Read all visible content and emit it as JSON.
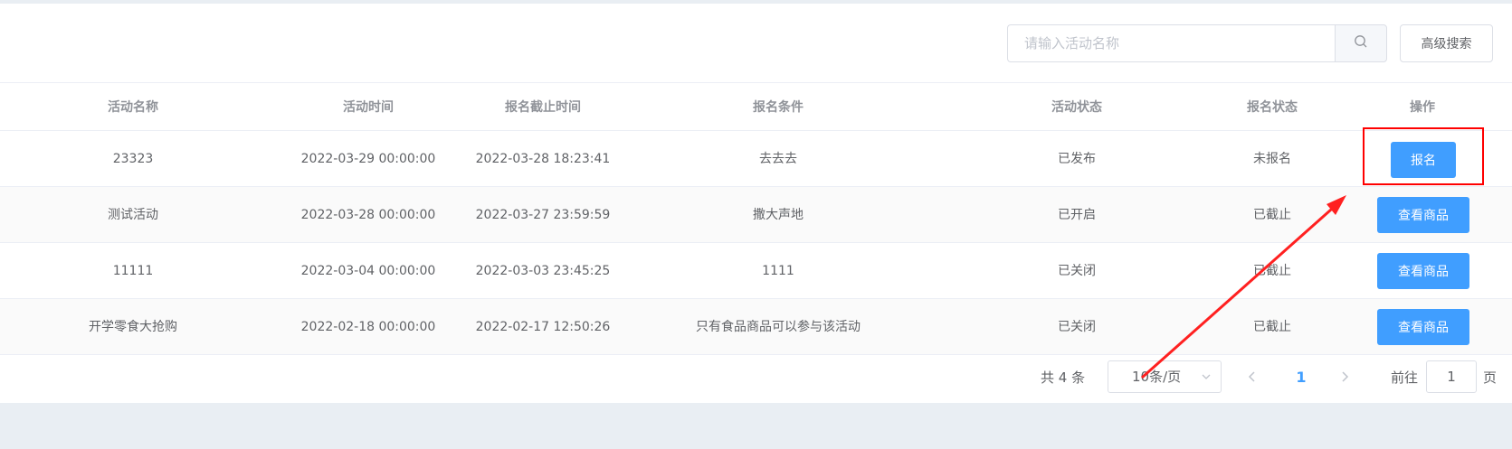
{
  "search": {
    "placeholder": "请输入活动名称",
    "value": "",
    "advanced_label": "高级搜索"
  },
  "table": {
    "headers": [
      "活动名称",
      "活动时间",
      "报名截止时间",
      "报名条件",
      "活动状态",
      "报名状态",
      "操作"
    ],
    "rows": [
      {
        "name": "23323",
        "time": "2022-03-29 00:00:00",
        "deadline": "2022-03-28 18:23:41",
        "condition": "去去去",
        "activity_status": "已发布",
        "signup_status": "未报名",
        "action": "报名"
      },
      {
        "name": "测试活动",
        "time": "2022-03-28 00:00:00",
        "deadline": "2022-03-27 23:59:59",
        "condition": "撒大声地",
        "activity_status": "已开启",
        "signup_status": "已截止",
        "action": "查看商品"
      },
      {
        "name": "11111",
        "time": "2022-03-04 00:00:00",
        "deadline": "2022-03-03 23:45:25",
        "condition": "1111",
        "activity_status": "已关闭",
        "signup_status": "已截止",
        "action": "查看商品"
      },
      {
        "name": "开学零食大抢购",
        "time": "2022-02-18 00:00:00",
        "deadline": "2022-02-17 12:50:26",
        "condition": "只有食品商品可以参与该活动",
        "activity_status": "已关闭",
        "signup_status": "已截止",
        "action": "查看商品"
      }
    ]
  },
  "pagination": {
    "total_label": "共 4 条",
    "page_size_label": "10条/页",
    "current_page": "1",
    "goto_label": "前往",
    "goto_value": "1",
    "goto_unit": "页"
  },
  "colors": {
    "primary": "#409eff",
    "annotation": "#ff0000"
  },
  "icons": {
    "search": "search-icon",
    "caret": "chevron-down-icon",
    "prev": "chevron-left-icon",
    "next": "chevron-right-icon"
  }
}
